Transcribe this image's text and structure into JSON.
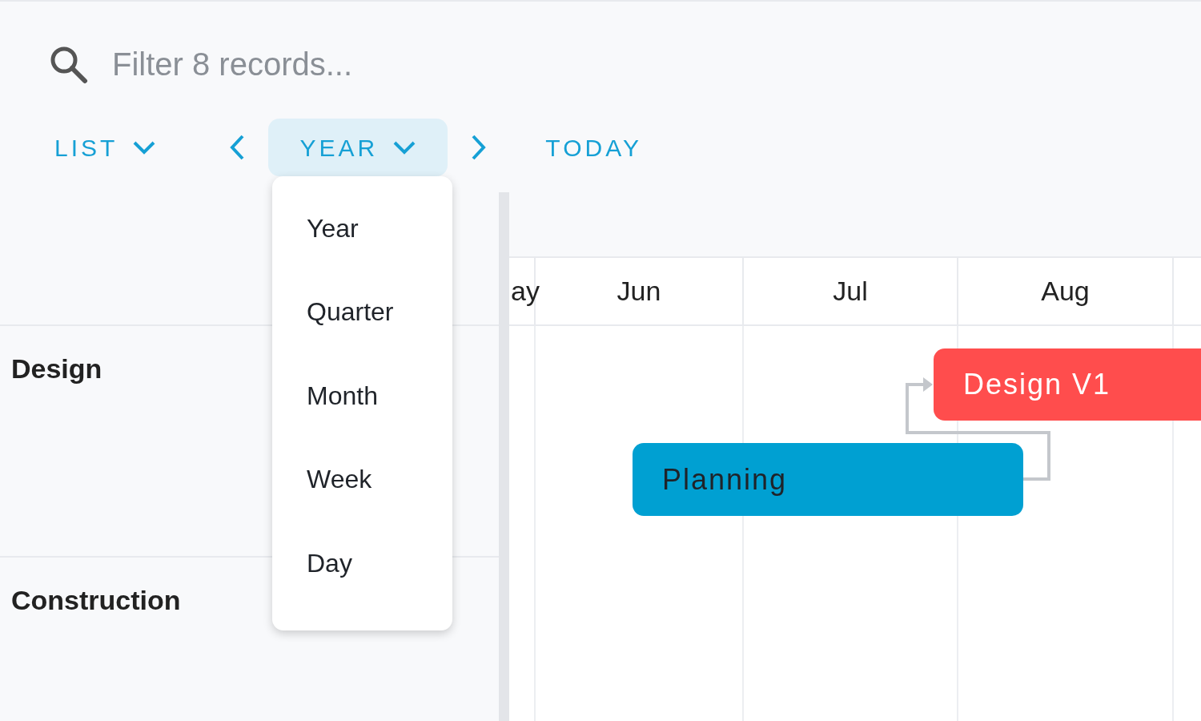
{
  "search": {
    "placeholder": "Filter 8 records..."
  },
  "toolbar": {
    "view_menu": "LIST",
    "zoom_menu": "YEAR",
    "today": "TODAY"
  },
  "zoom_dropdown": [
    "Year",
    "Quarter",
    "Month",
    "Week",
    "Day"
  ],
  "rows": [
    {
      "label": "Design"
    },
    {
      "label": "Construction"
    }
  ],
  "timeline": {
    "months": [
      "ay",
      "Jun",
      "Jul",
      "Aug"
    ]
  },
  "tasks": [
    {
      "label": "Design V1",
      "color": "#ff4d4d"
    },
    {
      "label": "Planning",
      "color": "#00a0d2"
    }
  ]
}
